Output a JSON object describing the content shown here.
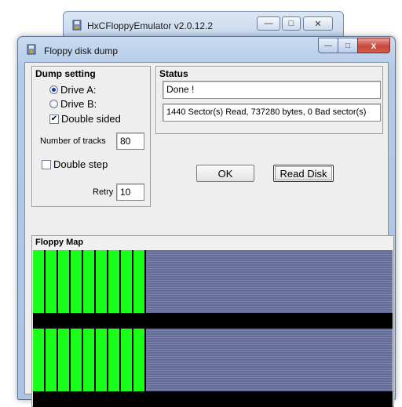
{
  "parent_window": {
    "title": "HxCFloppyEmulator v2.0.12.2",
    "buttons": [
      "—",
      "□",
      "✕"
    ]
  },
  "dialog": {
    "title": "Floppy disk dump",
    "controls": {
      "minimize": "—",
      "maximize": "□",
      "close": "x"
    }
  },
  "dump_setting": {
    "title": "Dump setting",
    "drive_a": "Drive A:",
    "drive_b": "Drive B:",
    "selected_drive": "Drive A:",
    "double_sided": "Double sided",
    "double_sided_checked": true,
    "tracks_label": "Number of tracks",
    "tracks_value": "80",
    "double_step": "Double step",
    "double_step_checked": false,
    "retry_label": "Retry",
    "retry_value": "10"
  },
  "status": {
    "title": "Status",
    "line1": "Done !",
    "line2": "1440 Sector(s) Read, 737280 bytes, 0 Bad sector(s)"
  },
  "buttons": {
    "ok": "OK",
    "read_disk": "Read Disk"
  },
  "floppy_map": {
    "title": "Floppy Map",
    "green_cells_per_side": 9,
    "colors": {
      "read_ok": "#19ff19",
      "unread": "#6b739c",
      "separator": "#000000"
    }
  }
}
